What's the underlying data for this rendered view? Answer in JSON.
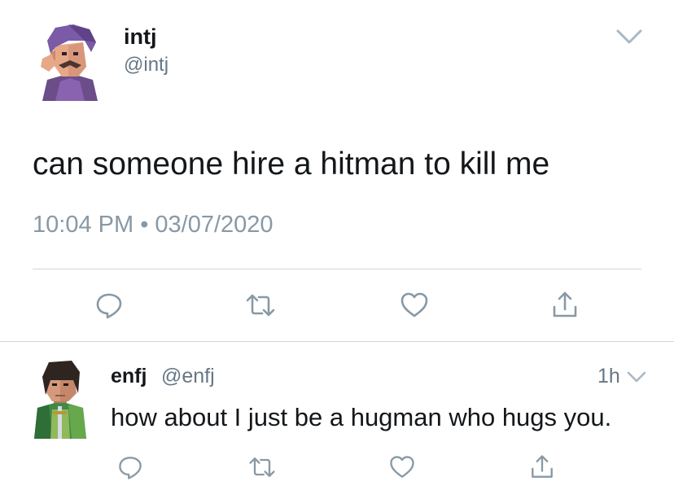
{
  "colors": {
    "text_primary": "#14171a",
    "text_secondary": "#657786",
    "meta": "#8899a6",
    "divider": "#ccd6dd",
    "icon": "#8899a6"
  },
  "main_tweet": {
    "display_name": "intj",
    "handle": "@intj",
    "text": "can someone hire a hitman to kill me",
    "time": "10:04 PM",
    "separator": "•",
    "date": "03/07/2020",
    "avatar_icon": "purple-haired-man-avatar",
    "actions": [
      "reply-icon",
      "retweet-icon",
      "like-icon",
      "share-icon"
    ]
  },
  "reply_tweet": {
    "display_name": "enfj",
    "handle": "@enfj",
    "time_ago": "1h",
    "text": "how about I just be a hugman who hugs you.",
    "avatar_icon": "green-cloaked-warrior-avatar",
    "actions": [
      "reply-icon",
      "retweet-icon",
      "like-icon",
      "share-icon"
    ]
  }
}
